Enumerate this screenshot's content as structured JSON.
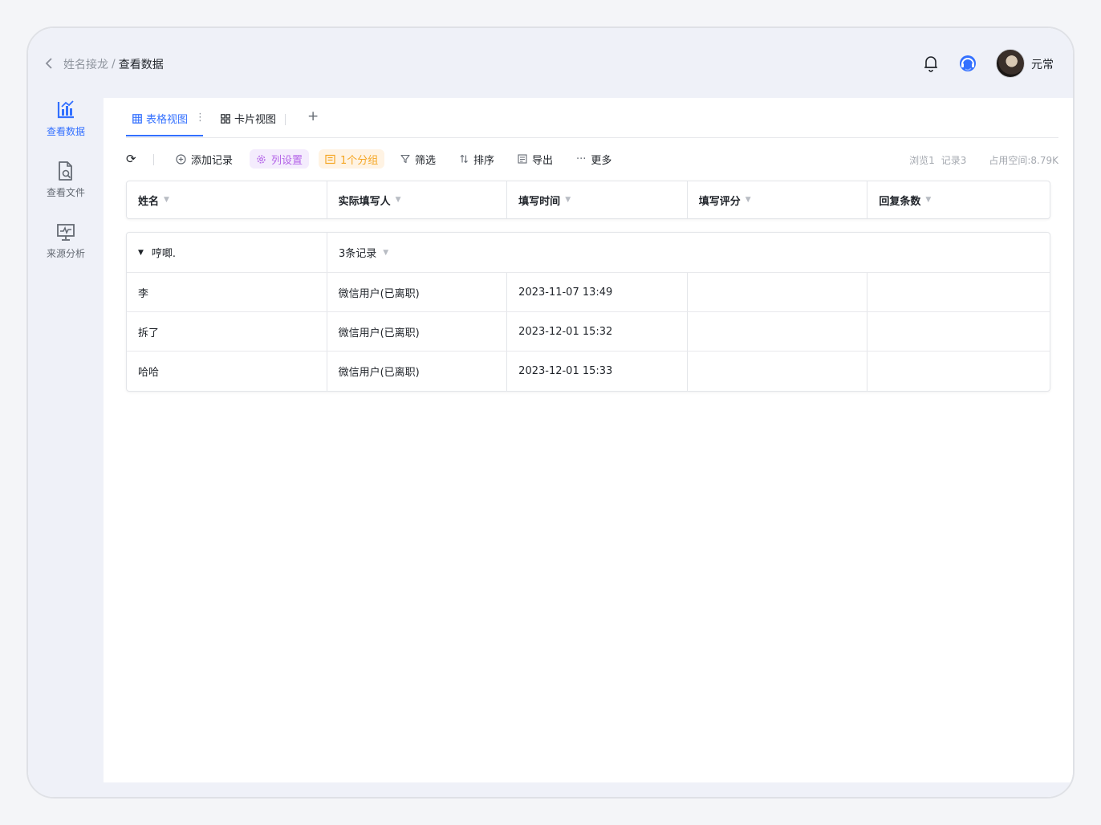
{
  "header": {
    "breadcrumb_parent": "姓名接龙",
    "breadcrumb_sep": "/",
    "breadcrumb_current": "查看数据",
    "user_name": "元常"
  },
  "sidebar": {
    "items": [
      {
        "label": "查看数据",
        "icon": "chart-icon",
        "active": true
      },
      {
        "label": "查看文件",
        "icon": "file-search-icon",
        "active": false
      },
      {
        "label": "来源分析",
        "icon": "monitor-analysis-icon",
        "active": false
      }
    ]
  },
  "tabs": {
    "items": [
      {
        "label": "表格视图",
        "icon": "grid-table-icon",
        "active": true
      },
      {
        "label": "卡片视图",
        "icon": "card-grid-icon",
        "active": false
      }
    ],
    "kebab": "⋮",
    "add": "+"
  },
  "toolbar": {
    "refresh_icon": "⟳",
    "add_record": "添加记录",
    "column_settings": "列设置",
    "group": "1个分组",
    "filter": "筛选",
    "sort": "排序",
    "export": "导出",
    "more": "更多",
    "stats_views": "浏览1",
    "stats_records": "记录3",
    "stats_space": "占用空间:8.79K"
  },
  "table": {
    "columns": [
      "姓名",
      "实际填写人",
      "填写时间",
      "填写评分",
      "回复条数"
    ],
    "group": {
      "name": "哼唧.",
      "count_label": "3条记录"
    },
    "rows": [
      {
        "name": "李",
        "filler": "微信用户(已离职)",
        "time": "2023-11-07 13:49",
        "score": "",
        "replies": ""
      },
      {
        "name": "拆了",
        "filler": "微信用户(已离职)",
        "time": "2023-12-01 15:32",
        "score": "",
        "replies": ""
      },
      {
        "name": "哈哈",
        "filler": "微信用户(已离职)",
        "time": "2023-12-01 15:33",
        "score": "",
        "replies": ""
      }
    ]
  },
  "colors": {
    "accent": "#3370ff",
    "purple_pill": "#b464e8",
    "orange_pill": "#f5a623"
  }
}
